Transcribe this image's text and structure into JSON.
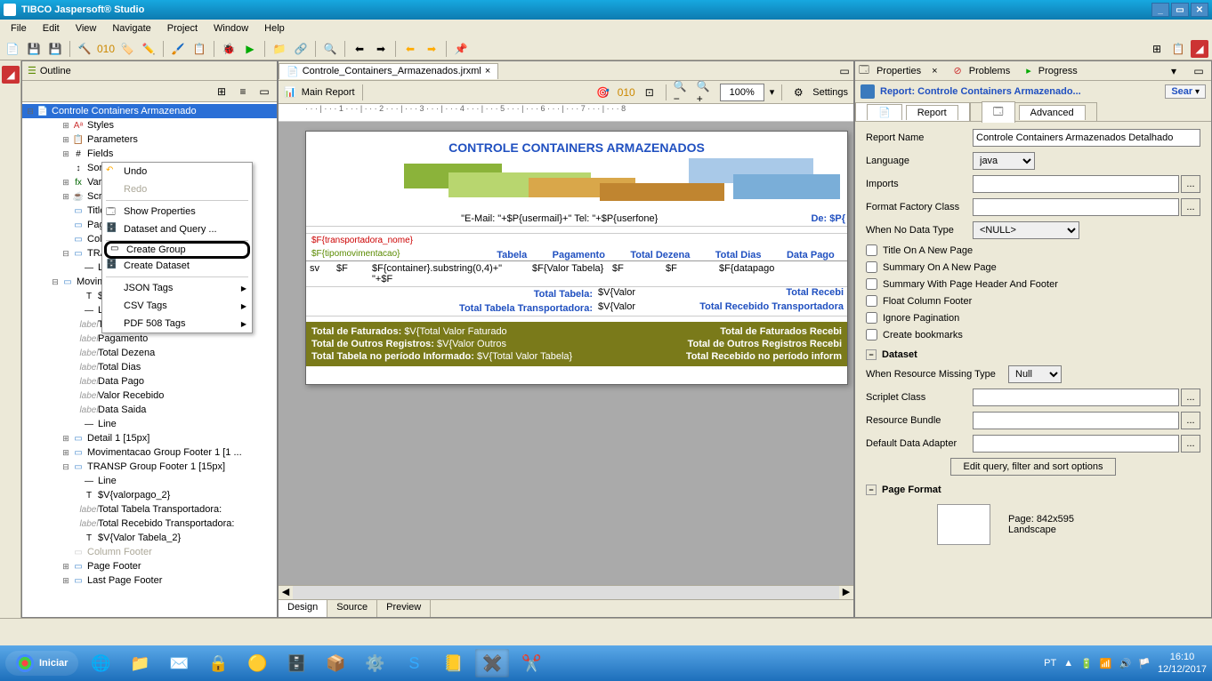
{
  "title": "TIBCO Jaspersoft® Studio",
  "menus": [
    "File",
    "Edit",
    "View",
    "Navigate",
    "Project",
    "Window",
    "Help"
  ],
  "outline": {
    "title": "Outline",
    "root": "Controle Containers Armazenado",
    "items1": [
      "Styles",
      "Parameters",
      "Fields",
      "Sort Fields",
      "Variables",
      "Scriptlets",
      "Title",
      "Page Header",
      "Column Header",
      "TRANSP Group Header",
      ""
    ],
    "groupHeader": "Movimentacao Group Header 1 [3 ...",
    "groupItems": [
      "$F{tipomovimentacao}",
      "Line",
      "Tabela",
      "Pagamento",
      "Total Dezena",
      "Total Dias",
      "Data Pago",
      "Valor Recebido",
      "Data Saida",
      "Line"
    ],
    "after": [
      "Detail 1 [15px]",
      "Movimentacao Group Footer 1 [1 ...",
      "TRANSP Group Footer 1 [15px]"
    ],
    "footerItems": [
      "Line",
      "$V{valorpago_2}",
      "Total Tabela Transportadora:",
      "Total Recebido Transportadora:",
      "$V{Valor Tabela_2}"
    ],
    "columnFooter": "Column Footer",
    "end": [
      "Page Footer",
      "Last Page Footer"
    ]
  },
  "contextMenu": {
    "undo": "Undo",
    "redo": "Redo",
    "showProps": "Show Properties",
    "dataset": "Dataset and Query ...",
    "createGroup": "Create Group",
    "createDataset": "Create Dataset",
    "json": "JSON Tags",
    "csv": "CSV Tags",
    "pdf": "PDF 508 Tags"
  },
  "editor": {
    "filename": "Controle_Containers_Armazenados.jrxml",
    "mainReport": "Main Report",
    "zoom": "100%",
    "settings": "Settings",
    "tabs": [
      "Design",
      "Source",
      "Preview"
    ]
  },
  "report": {
    "title": "CONTROLE CONTAINERS ARMAZENADOS",
    "email": "\"E-Mail: \"+$P{usermail}+\" Tel: \"+$P{userfone}",
    "de": "De:",
    "dep": "$P{",
    "transp": "$F{transportadora_nome}",
    "tipo": "$F{tipomovimentacao}",
    "headers": [
      "sv",
      "$F",
      "Tabela",
      "Pagamento",
      "Total Dezena",
      "Total Dias",
      "Data Pago"
    ],
    "row": [
      "sv",
      "$F",
      "$F{container}.substring(0,4)+\" \"+$F",
      "$F{Valor Tabela}",
      "$F",
      "$F",
      "$F{datapago"
    ],
    "totalTabela": "Total Tabela:",
    "totalTabelaV": "$V{Valor",
    "totalRecebi": "Total Recebi",
    "totalTransp": "Total Tabela Transportadora:",
    "totalTranspV": "$V{Valor",
    "totalRecebiTransp": "Total Recebido Transportadora",
    "s1l": "Total de Faturados:",
    "s1r": "$V{Total Valor Faturado",
    "s1rr": "Total de Faturados Recebi",
    "s2l": "Total de Outros Registros:",
    "s2r": "$V{Valor Outros",
    "s2rr": "Total de Outros Registros Recebi",
    "s3l": "Total Tabela no período Informado:",
    "s3r": "$V{Total Valor Tabela}",
    "s3rr": "Total Recebido no período inform"
  },
  "props": {
    "tab1": "Properties",
    "tab2": "Problems",
    "tab3": "Progress",
    "header": "Report: Controle Containers Armazenado...",
    "search": "Sear",
    "sub1": "Report",
    "sub2": "Advanced",
    "reportName": "Report Name",
    "reportNameV": "Controle Containers Armazenados Detalhado",
    "language": "Language",
    "languageV": "java",
    "imports": "Imports",
    "ffc": "Format Factory Class",
    "wndt": "When No Data Type",
    "wndtV": "<NULL>",
    "cb1": "Title On A New Page",
    "cb2": "Summary On A New Page",
    "cb3": "Summary With Page Header And Footer",
    "cb4": "Float Column Footer",
    "cb5": "Ignore Pagination",
    "cb6": "Create bookmarks",
    "dataset": "Dataset",
    "wrmt": "When Resource Missing Type",
    "wrmtV": "Null",
    "scriptlet": "Scriplet Class",
    "bundle": "Resource Bundle",
    "dda": "Default Data Adapter",
    "editQuery": "Edit query, filter and sort options",
    "pageFormat": "Page Format",
    "pageLabel": "Page:",
    "pageSize": "842x595",
    "pageOrient": "Landscape"
  },
  "taskbar": {
    "start": "Iniciar",
    "lang": "PT",
    "time": "16:10",
    "date": "12/12/2017"
  }
}
